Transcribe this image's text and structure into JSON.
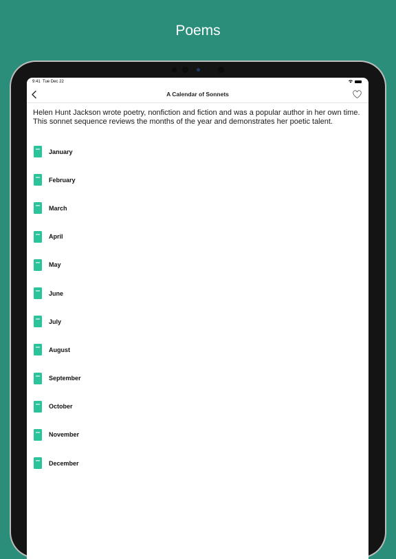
{
  "promo": {
    "title": "Poems"
  },
  "status_bar": {
    "time": "9:41",
    "date": "Tue Dec 22"
  },
  "nav": {
    "title": "A Calendar of Sonnets",
    "back_icon": "chevron-left-icon",
    "favorite_icon": "heart-outline-icon"
  },
  "intro": "Helen Hunt Jackson wrote poetry, nonfiction and fiction and was a popular author in her own time. This sonnet sequence reviews the months of the year and demonstrates her poetic talent.",
  "colors": {
    "background": "#2a8e7b",
    "accent": "#2bc39a"
  },
  "poems": [
    {
      "label": "January",
      "icon": "book-icon"
    },
    {
      "label": "February",
      "icon": "book-icon"
    },
    {
      "label": "March",
      "icon": "book-icon"
    },
    {
      "label": "April",
      "icon": "book-icon"
    },
    {
      "label": "May",
      "icon": "book-icon"
    },
    {
      "label": "June",
      "icon": "book-icon"
    },
    {
      "label": "July",
      "icon": "book-icon"
    },
    {
      "label": "August",
      "icon": "book-icon"
    },
    {
      "label": "September",
      "icon": "book-icon"
    },
    {
      "label": "October",
      "icon": "book-icon"
    },
    {
      "label": "November",
      "icon": "book-icon"
    },
    {
      "label": "December",
      "icon": "book-icon"
    }
  ]
}
